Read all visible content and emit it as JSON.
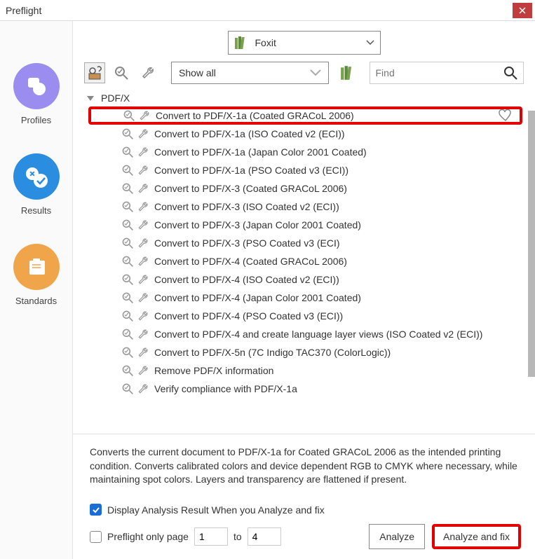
{
  "window": {
    "title": "Preflight"
  },
  "sidebar": {
    "items": [
      {
        "label": "Profiles",
        "color": "#9b8cf0"
      },
      {
        "label": "Results",
        "color": "#2b8de0"
      },
      {
        "label": "Standards",
        "color": "#f0a54a"
      }
    ]
  },
  "brand": {
    "name": "Foxit"
  },
  "toolbar": {
    "show_label": "Show all",
    "search_placeholder": "Find"
  },
  "tree": {
    "category": "PDF/X",
    "items": [
      {
        "label": "Convert to PDF/X-1a (Coated GRACoL 2006)",
        "highlighted": true
      },
      {
        "label": "Convert to PDF/X-1a (ISO Coated v2 (ECI))"
      },
      {
        "label": "Convert to PDF/X-1a (Japan Color 2001 Coated)"
      },
      {
        "label": "Convert to PDF/X-1a (PSO Coated v3 (ECI))"
      },
      {
        "label": "Convert to PDF/X-3 (Coated GRACoL 2006)"
      },
      {
        "label": "Convert to PDF/X-3 (ISO Coated v2 (ECI))"
      },
      {
        "label": "Convert to PDF/X-3 (Japan Color 2001 Coated)"
      },
      {
        "label": "Convert to PDF/X-3 (PSO Coated v3 (ECI)"
      },
      {
        "label": "Convert to PDF/X-4 (Coated GRACoL 2006)"
      },
      {
        "label": "Convert to PDF/X-4 (ISO Coated v2 (ECI))"
      },
      {
        "label": "Convert to PDF/X-4 (Japan Color 2001 Coated)"
      },
      {
        "label": "Convert to PDF/X-4 (PSO Coated v3 (ECI))"
      },
      {
        "label": "Convert to PDF/X-4 and create language layer views (ISO Coated v2 (ECI))"
      },
      {
        "label": "Convert to PDF/X-5n (7C Indigo TAC370 (ColorLogic))"
      },
      {
        "label": "Remove PDF/X information"
      },
      {
        "label": "Verify compliance with PDF/X-1a"
      }
    ]
  },
  "description": "Converts the current document to PDF/X-1a for Coated GRACoL 2006 as the intended printing condition. Converts calibrated colors and device dependent RGB to CMYK where necessary, while maintaining spot colors. Layers and transparency are flattened if present.",
  "options": {
    "display_analysis_label": "Display Analysis Result When you Analyze and fix",
    "display_analysis_checked": true,
    "preflight_only_label": "Preflight only page",
    "preflight_only_checked": false,
    "page_from": "1",
    "page_to_label": "to",
    "page_to": "4"
  },
  "buttons": {
    "analyze": "Analyze",
    "analyze_fix": "Analyze and fix"
  }
}
